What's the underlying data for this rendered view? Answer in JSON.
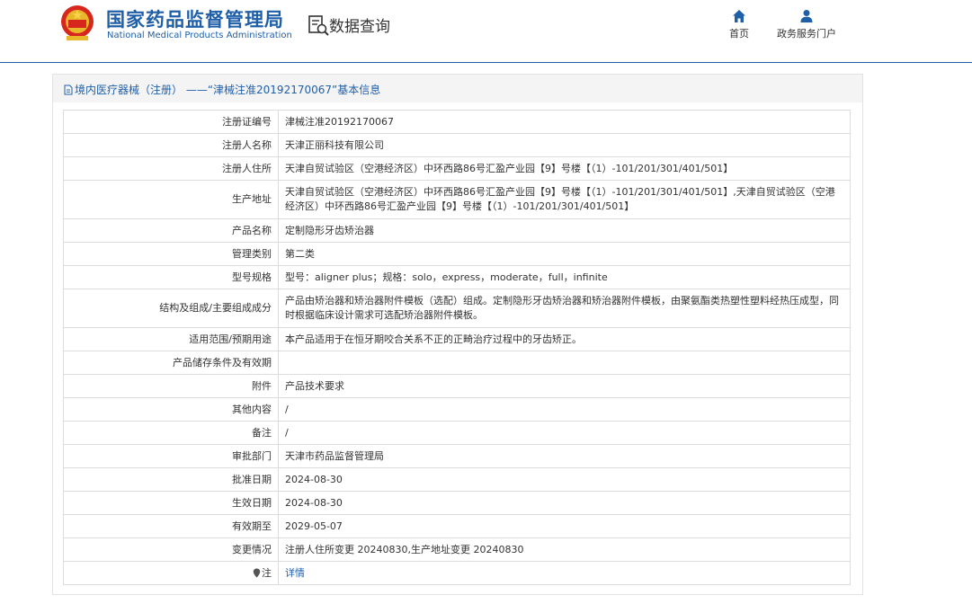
{
  "header": {
    "site_title": "国家药品监督管理局",
    "site_subtitle": "National Medical Products Administration",
    "query_label": "数据查询",
    "nav": [
      {
        "label": "首页",
        "icon": "home-icon"
      },
      {
        "label": "政务服务门户",
        "icon": "user-icon"
      }
    ]
  },
  "panel": {
    "title": "境内医疗器械（注册） ——“津械注准20192170067”基本信息"
  },
  "rows": [
    {
      "label": "注册证编号",
      "value": "津械注准20192170067"
    },
    {
      "label": "注册人名称",
      "value": "天津正丽科技有限公司"
    },
    {
      "label": "注册人住所",
      "value": "天津自贸试验区（空港经济区）中环西路86号汇盈产业园【9】号楼【（1）-101/201/301/401/501】"
    },
    {
      "label": "生产地址",
      "value": "天津自贸试验区（空港经济区）中环西路86号汇盈产业园【9】号楼【（1）-101/201/301/401/501】,天津自贸试验区（空港经济区）中环西路86号汇盈产业园【9】号楼【（1）-101/201/301/401/501】"
    },
    {
      "label": "产品名称",
      "value": "定制隐形牙齿矫治器"
    },
    {
      "label": "管理类别",
      "value": "第二类"
    },
    {
      "label": "型号规格",
      "value": "型号：aligner plus；规格：solo，express，moderate，full，infinite"
    },
    {
      "label": "结构及组成/主要组成成分",
      "value": "产品由矫治器和矫治器附件模板（选配）组成。定制隐形牙齿矫治器和矫治器附件模板，由聚氨酯类热塑性塑料经热压成型，同时根据临床设计需求可选配矫治器附件模板。"
    },
    {
      "label": "适用范围/预期用途",
      "value": "本产品适用于在恒牙期咬合关系不正的正畸治疗过程中的牙齿矫正。"
    },
    {
      "label": "产品储存条件及有效期",
      "value": ""
    },
    {
      "label": "附件",
      "value": "产品技术要求"
    },
    {
      "label": "其他内容",
      "value": "/"
    },
    {
      "label": "备注",
      "value": "/"
    },
    {
      "label": "审批部门",
      "value": "天津市药品监督管理局"
    },
    {
      "label": "批准日期",
      "value": "2024-08-30"
    },
    {
      "label": "生效日期",
      "value": "2024-08-30"
    },
    {
      "label": "有效期至",
      "value": "2029-05-07"
    },
    {
      "label": "变更情况",
      "value": "注册人住所变更 20240830,生产地址变更 20240830"
    }
  ],
  "note": {
    "label": "注",
    "icon": "pin-icon",
    "link": "详情"
  }
}
